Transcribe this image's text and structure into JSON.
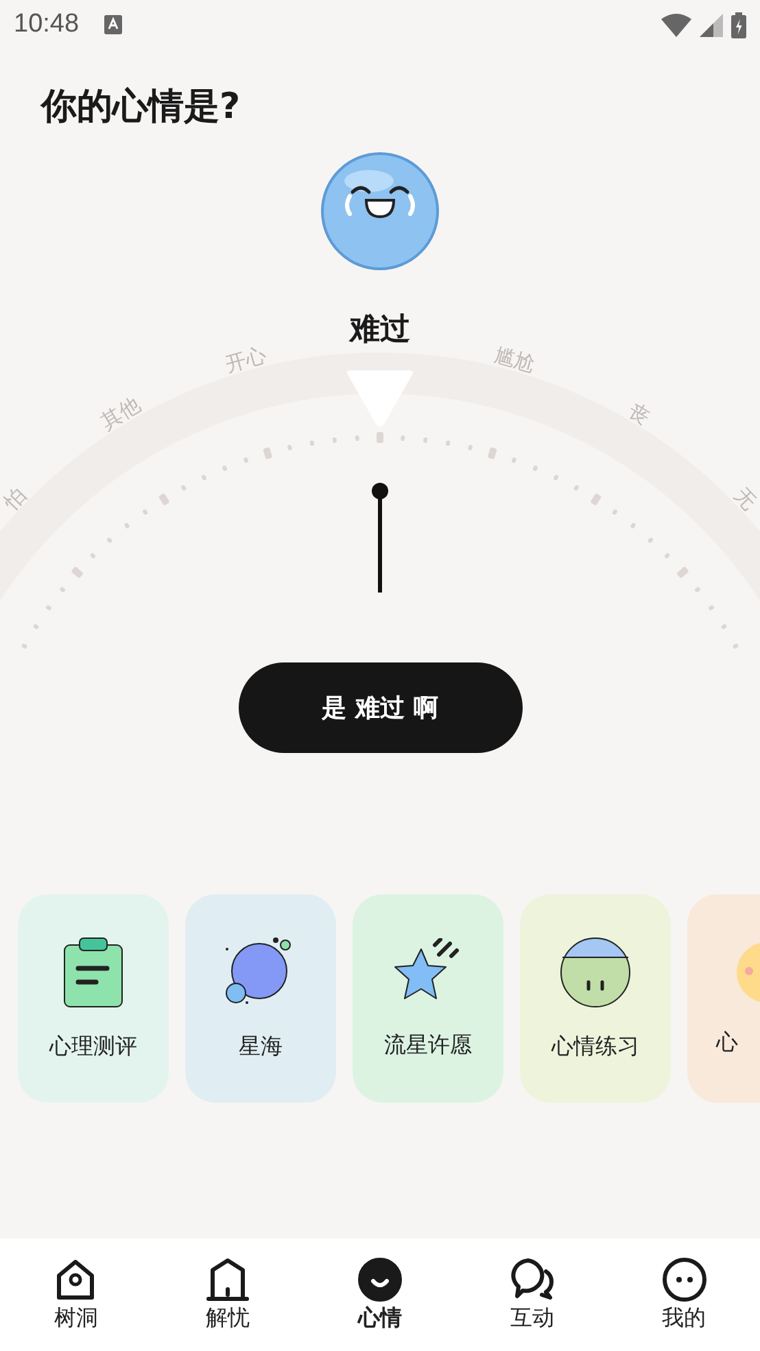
{
  "status_bar": {
    "time": "10:48"
  },
  "title": "你的心情是?",
  "mood": {
    "label": "难过"
  },
  "dial": {
    "labels": [
      {
        "text": "怕"
      },
      {
        "text": "其他"
      },
      {
        "text": "开心"
      },
      {
        "text": "尴尬"
      },
      {
        "text": "丧"
      },
      {
        "text": "无"
      }
    ]
  },
  "confirm_button": "是 难过 啊",
  "cards": [
    {
      "kind": "clipboard",
      "label": "心理测评",
      "color": "#e3f4ef"
    },
    {
      "kind": "planet",
      "label": "星海",
      "color": "#e0eef3"
    },
    {
      "kind": "star",
      "label": "流星许愿",
      "color": "#dcf3e2"
    },
    {
      "kind": "ball",
      "label": "心情练习",
      "color": "#eef4dc"
    },
    {
      "kind": "emoji",
      "label": "心",
      "color": "#f8e9da"
    }
  ],
  "nav": [
    {
      "kind": "house",
      "label": "树洞",
      "selected": false
    },
    {
      "kind": "hut",
      "label": "解忧",
      "selected": false
    },
    {
      "kind": "smile",
      "label": "心情",
      "selected": true
    },
    {
      "kind": "chat",
      "label": "互动",
      "selected": false
    },
    {
      "kind": "face",
      "label": "我的",
      "selected": false
    }
  ]
}
